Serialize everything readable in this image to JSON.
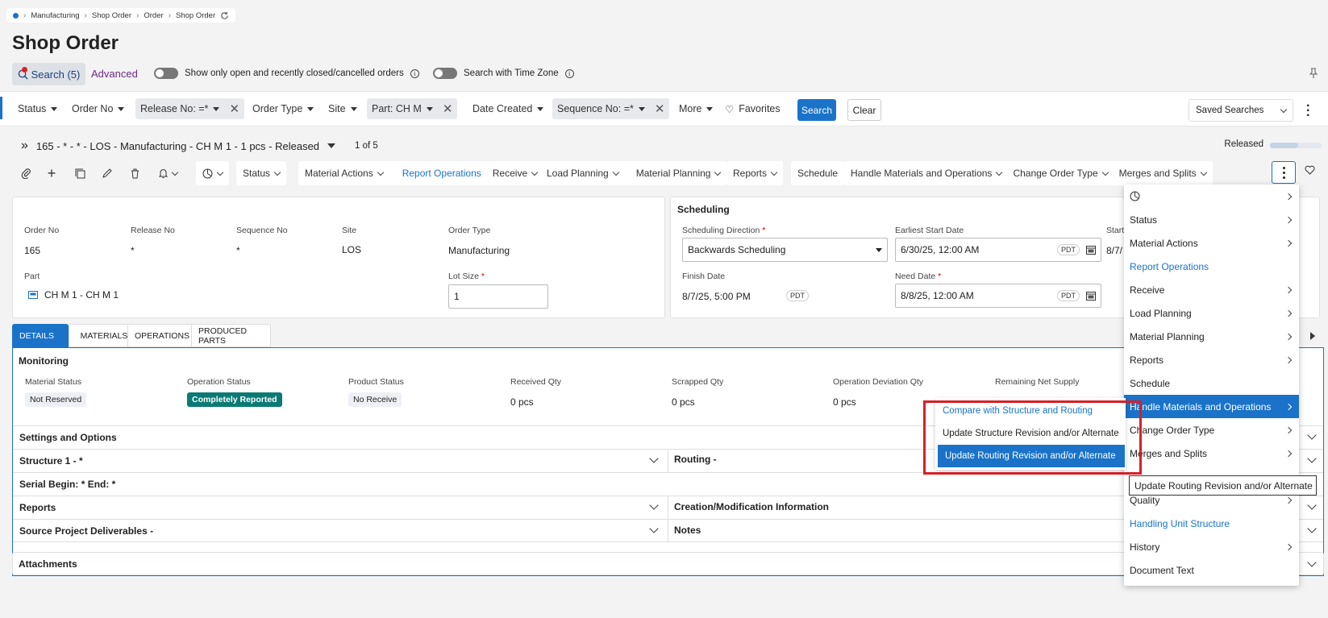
{
  "breadcrumb": [
    "Manufacturing",
    "Shop Order",
    "Order",
    "Shop Order"
  ],
  "page_title": "Shop Order",
  "search": {
    "button_label": "Search (5)",
    "advanced_label": "Advanced",
    "toggle_open_label": "Show only open and recently closed/cancelled orders",
    "toggle_tz_label": "Search with Time Zone"
  },
  "filters": {
    "status": "Status",
    "order_no": "Order No",
    "release_no": "Release No: =*",
    "order_type": "Order Type",
    "site": "Site",
    "part": "Part: CH M",
    "date_created": "Date Created",
    "sequence_no": "Sequence No: =*",
    "more": "More",
    "favorites": "Favorites",
    "search_btn": "Search",
    "clear_btn": "Clear",
    "saved_searches": "Saved Searches"
  },
  "record": {
    "title": "165 - * - * - LOS - Manufacturing - CH M 1 - 1 pcs - Released",
    "count": "1 of 5",
    "state": "Released"
  },
  "toolbar": {
    "status": "Status",
    "material_actions": "Material Actions",
    "report_operations": "Report Operations",
    "receive": "Receive",
    "load_planning": "Load Planning",
    "material_planning": "Material Planning",
    "reports": "Reports",
    "schedule": "Schedule",
    "handle_materials": "Handle Materials and Operations",
    "change_order_type": "Change Order Type",
    "merges_splits": "Merges and Splits"
  },
  "header_fields": {
    "order_no_label": "Order No",
    "order_no": "165",
    "release_no_label": "Release No",
    "release_no": "*",
    "sequence_no_label": "Sequence No",
    "sequence_no": "*",
    "site_label": "Site",
    "site": "LOS",
    "order_type_label": "Order Type",
    "order_type": "Manufacturing",
    "part_label": "Part",
    "part": "CH M 1 - CH M 1",
    "lot_size_label": "Lot Size",
    "lot_size": "1"
  },
  "scheduling": {
    "title": "Scheduling",
    "direction_label": "Scheduling Direction",
    "direction": "Backwards Scheduling",
    "earliest_start_label": "Earliest Start Date",
    "earliest_start": "6/30/25, 12:00 AM",
    "start_label": "Start",
    "start_value": "8/7/",
    "finish_label": "Finish Date",
    "finish": "8/7/25, 5:00 PM",
    "need_label": "Need Date",
    "need": "8/8/25, 12:00 AM",
    "tz": "PDT"
  },
  "tabs": [
    "DETAILS",
    "MATERIALS",
    "OPERATIONS",
    "PRODUCED PARTS"
  ],
  "monitoring": {
    "title": "Monitoring",
    "material_status_label": "Material Status",
    "material_status": "Not Reserved",
    "operation_status_label": "Operation Status",
    "operation_status": "Completely Reported",
    "product_status_label": "Product Status",
    "product_status": "No Receive",
    "received_label": "Received Qty",
    "received": "0 pcs",
    "scrapped_label": "Scrapped Qty",
    "scrapped": "0 pcs",
    "deviation_label": "Operation Deviation Qty",
    "deviation": "0 pcs",
    "remaining_label": "Remaining Net Supply"
  },
  "sections": {
    "settings": "Settings and Options",
    "structure": "Structure 1 - *",
    "routing": "Routing -",
    "serial": "Serial Begin: * End: *",
    "reports": "Reports",
    "creation": "Creation/Modification Information",
    "source": "Source Project Deliverables -",
    "notes": "Notes",
    "attachments": "Attachments"
  },
  "menu": {
    "status": "Status",
    "material_actions": "Material Actions",
    "report_operations": "Report Operations",
    "receive": "Receive",
    "load_planning": "Load Planning",
    "material_planning": "Material Planning",
    "reports": "Reports",
    "schedule": "Schedule",
    "handle_materials": "Handle Materials and Operations",
    "change_order_type": "Change Order Type",
    "merges_splits": "Merges and Splits",
    "quality": "Quality",
    "handling_unit": "Handling Unit Structure",
    "history": "History",
    "document_text": "Document Text"
  },
  "submenu": {
    "compare": "Compare with Structure and Routing",
    "update_structure": "Update Structure Revision and/or Alternate",
    "update_routing": "Update Routing Revision and/or Alternate"
  },
  "tooltip": "Update Routing Revision and/or Alternate",
  "colors": {
    "accent": "#1a73c9",
    "highlight_box": "#d61f26",
    "operation_status_badge": "#0b7a75"
  }
}
